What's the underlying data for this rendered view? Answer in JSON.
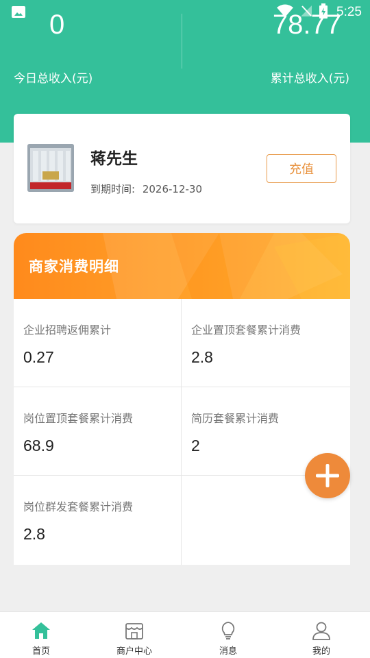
{
  "status_bar": {
    "time": "5:25",
    "icons": [
      "gallery-icon",
      "wifi-icon",
      "signal-off-icon",
      "battery-charging-icon"
    ]
  },
  "income": {
    "today_value": "0",
    "today_label": "今日总收入(元)",
    "total_value": "78.77",
    "total_label": "累计总收入(元)"
  },
  "profile": {
    "name": "蒋先生",
    "expire_label": "到期时间:",
    "expire_date": "2026-12-30",
    "recharge_label": "充值"
  },
  "details": {
    "title": "商家消费明细",
    "items": [
      {
        "label": "企业招聘返佣累计",
        "value": "0.27"
      },
      {
        "label": "企业置顶套餐累计消费",
        "value": "2.8"
      },
      {
        "label": "岗位置顶套餐累计消费",
        "value": "68.9"
      },
      {
        "label": "简历套餐累计消费",
        "value": "2"
      },
      {
        "label": "岗位群发套餐累计消费",
        "value": "2.8"
      }
    ]
  },
  "nav": {
    "items": [
      {
        "label": "首页",
        "icon": "home-icon",
        "active": true
      },
      {
        "label": "商户中心",
        "icon": "store-icon",
        "active": false
      },
      {
        "label": "消息",
        "icon": "lightbulb-icon",
        "active": false
      },
      {
        "label": "我的",
        "icon": "person-icon",
        "active": false
      }
    ]
  },
  "colors": {
    "header": "#34c09a",
    "accent_orange": "#ee8a3a",
    "banner_orange": "#ff9a24"
  }
}
